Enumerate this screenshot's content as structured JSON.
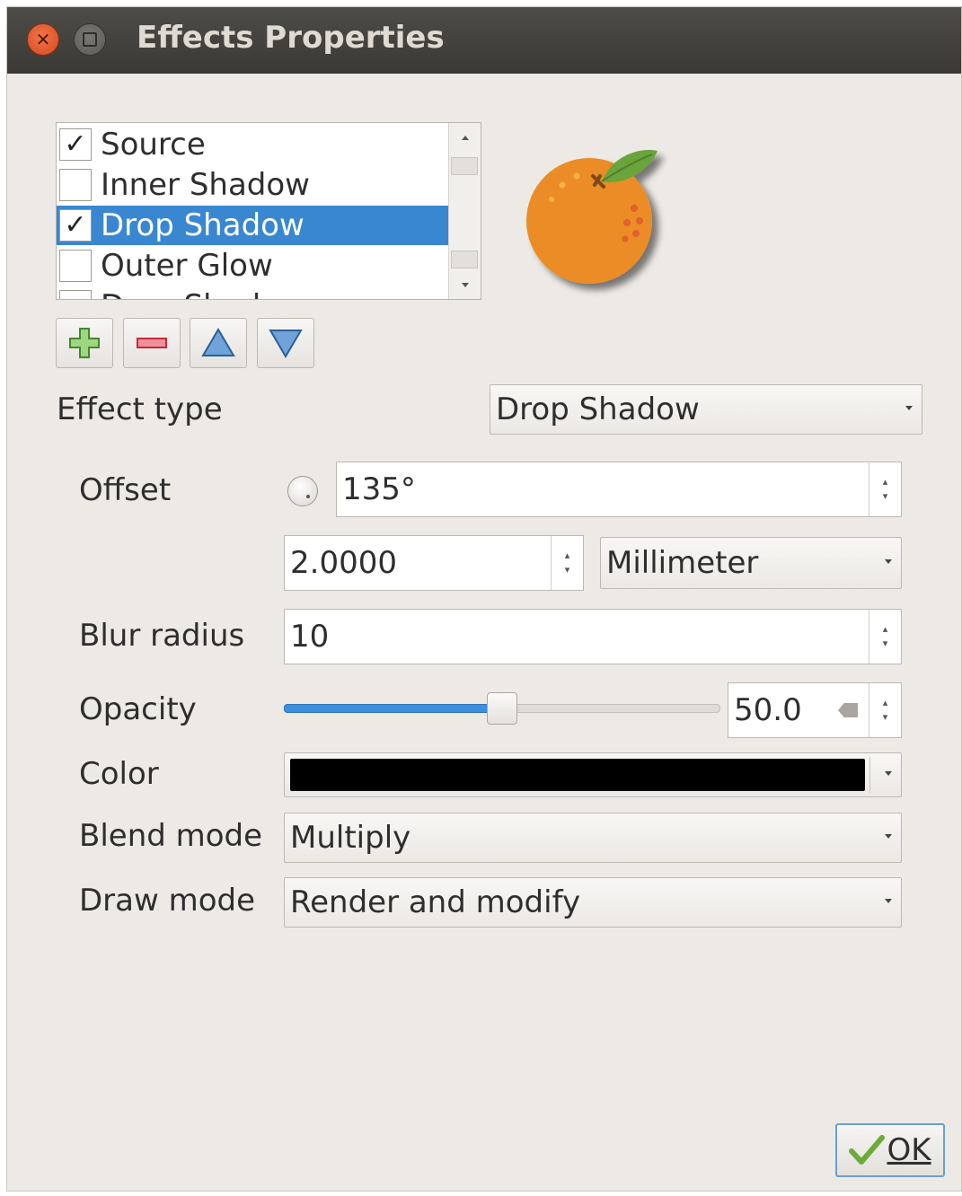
{
  "window": {
    "title": "Effects Properties"
  },
  "effects_list": {
    "items": [
      {
        "label": "Source",
        "checked": true,
        "selected": false
      },
      {
        "label": "Inner Shadow",
        "checked": false,
        "selected": false
      },
      {
        "label": "Drop Shadow",
        "checked": true,
        "selected": true
      },
      {
        "label": "Outer Glow",
        "checked": false,
        "selected": false
      },
      {
        "label": "Drop Shadow",
        "checked": false,
        "selected": false
      }
    ]
  },
  "toolbar": {
    "add_icon": "plus-icon",
    "remove_icon": "minus-icon",
    "up_icon": "arrow-up-icon",
    "down_icon": "arrow-down-icon"
  },
  "effect_type": {
    "label": "Effect type",
    "value": "Drop Shadow"
  },
  "offset": {
    "label": "Offset",
    "angle": "135°",
    "distance": "2.0000",
    "unit": "Millimeter"
  },
  "blur": {
    "label": "Blur radius",
    "value": "10"
  },
  "opacity": {
    "label": "Opacity",
    "value": "50.0",
    "fraction": 0.5
  },
  "color": {
    "label": "Color",
    "value": "#000000"
  },
  "blend_mode": {
    "label": "Blend mode",
    "value": "Multiply"
  },
  "draw_mode": {
    "label": "Draw mode",
    "value": "Render and modify"
  },
  "buttons": {
    "ok": "OK"
  },
  "colors": {
    "selection": "#3a87d1",
    "slider_fill": "#3d8ee0",
    "preview_orange": "#ec8c25",
    "leaf": "#6aa43a"
  }
}
